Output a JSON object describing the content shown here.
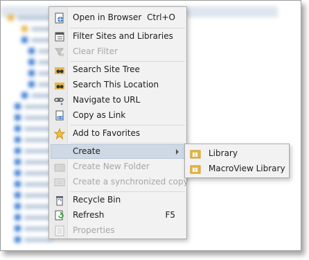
{
  "menu": {
    "items": [
      {
        "label": "Open in Browser",
        "shortcut": "Ctrl+O",
        "icon": "globe-page-icon",
        "enabled": true
      },
      {
        "label": "Filter Sites and Libraries",
        "shortcut": "",
        "icon": "filter-list-icon",
        "enabled": true
      },
      {
        "label": "Clear Filter",
        "shortcut": "",
        "icon": "funnel-clear-icon",
        "enabled": false
      },
      {
        "label": "Search Site Tree",
        "shortcut": "",
        "icon": "binoculars-folder-icon",
        "enabled": true
      },
      {
        "label": "Search This Location",
        "shortcut": "",
        "icon": "binoculars-folder-icon",
        "enabled": true
      },
      {
        "label": "Navigate to URL",
        "shortcut": "",
        "icon": "link-arrow-icon",
        "enabled": true
      },
      {
        "label": "Copy as Link",
        "shortcut": "",
        "icon": "copy-link-icon",
        "enabled": true
      },
      {
        "label": "Add to Favorites",
        "shortcut": "",
        "icon": "star-icon",
        "enabled": true
      },
      {
        "label": "Create",
        "shortcut": "",
        "icon": "",
        "enabled": true
      },
      {
        "label": "Create New Folder",
        "shortcut": "",
        "icon": "new-folder-icon",
        "enabled": false
      },
      {
        "label": "Create a synchronized copy",
        "shortcut": "",
        "icon": "sync-copy-icon",
        "enabled": false
      },
      {
        "label": "Recycle Bin",
        "shortcut": "",
        "icon": "recycle-bin-icon",
        "enabled": true
      },
      {
        "label": "Refresh",
        "shortcut": "F5",
        "icon": "refresh-icon",
        "enabled": true
      },
      {
        "label": "Properties",
        "shortcut": "",
        "icon": "properties-icon",
        "enabled": false
      }
    ]
  },
  "submenu": {
    "items": [
      {
        "label": "Library",
        "icon": "library-folder-icon"
      },
      {
        "label": "MacroView Library",
        "icon": "library-folder-icon"
      }
    ]
  },
  "colors": {
    "menu_bg": "#f2f2f2",
    "highlight": "#cfd9e6",
    "disabled_text": "#a6a6a6",
    "accent_blue": "#3f7ed3",
    "folder_yellow": "#e6b84a"
  }
}
